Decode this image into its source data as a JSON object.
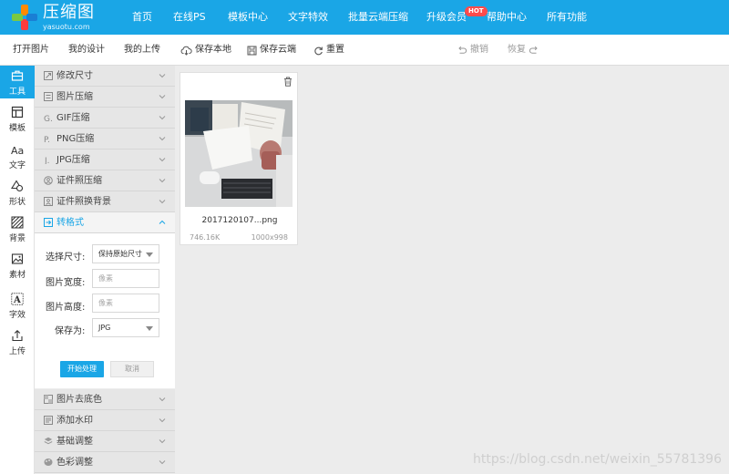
{
  "nav": {
    "brand": "压缩图",
    "domain": "yasuotu.com",
    "items": [
      "首页",
      "在线PS",
      "模板中心",
      "文字特效",
      "批量云端压缩",
      "升级会员",
      "帮助中心",
      "所有功能"
    ],
    "hot_badge": "HOT"
  },
  "toolbar": {
    "open": "打开图片",
    "my_design": "我的设计",
    "my_upload": "我的上传",
    "save_local": "保存本地",
    "save_cloud": "保存云端",
    "reset": "重置",
    "undo": "撤销",
    "redo": "恢复"
  },
  "sidebar": {
    "items": [
      {
        "label": "工具",
        "icon": "toolbox-icon"
      },
      {
        "label": "模板",
        "icon": "template-icon"
      },
      {
        "label": "文字",
        "icon": "text-icon"
      },
      {
        "label": "形状",
        "icon": "shape-icon"
      },
      {
        "label": "背景",
        "icon": "background-icon"
      },
      {
        "label": "素材",
        "icon": "image-icon"
      },
      {
        "label": "字效",
        "icon": "text-effect-icon"
      },
      {
        "label": "上传",
        "icon": "upload-icon"
      }
    ]
  },
  "panel": {
    "sections": [
      {
        "label": "修改尺寸",
        "icon": "resize-icon"
      },
      {
        "label": "图片压缩",
        "icon": "compress-icon"
      },
      {
        "label": "GIF压缩",
        "icon": "gif-icon"
      },
      {
        "label": "PNG压缩",
        "icon": "png-icon"
      },
      {
        "label": "JPG压缩",
        "icon": "jpg-icon"
      },
      {
        "label": "证件照压缩",
        "icon": "id-photo-icon"
      },
      {
        "label": "证件照换背景",
        "icon": "id-background-icon"
      },
      {
        "label": "转格式",
        "icon": "convert-icon"
      }
    ],
    "bottom_sections": [
      {
        "label": "图片去底色",
        "icon": "remove-bg-icon"
      },
      {
        "label": "添加水印",
        "icon": "watermark-icon"
      },
      {
        "label": "基础调整",
        "icon": "adjust-icon"
      },
      {
        "label": "色彩调整",
        "icon": "color-icon"
      }
    ],
    "form": {
      "size_label": "选择尺寸:",
      "size_value": "保持原始尺寸",
      "width_label": "图片宽度:",
      "width_placeholder": "像素",
      "height_label": "图片高度:",
      "height_placeholder": "像素",
      "save_as_label": "保存为:",
      "save_as_value": "JPG",
      "start_button": "开始处理",
      "cancel_button": "取消"
    }
  },
  "file": {
    "name": "2017120107...png",
    "size": "746.16K",
    "dimensions": "1000x998"
  },
  "watermark": "https://blog.csdn.net/weixin_55781396",
  "colors": {
    "accent": "#1aa6e6",
    "hot": "#ff4b4b"
  }
}
